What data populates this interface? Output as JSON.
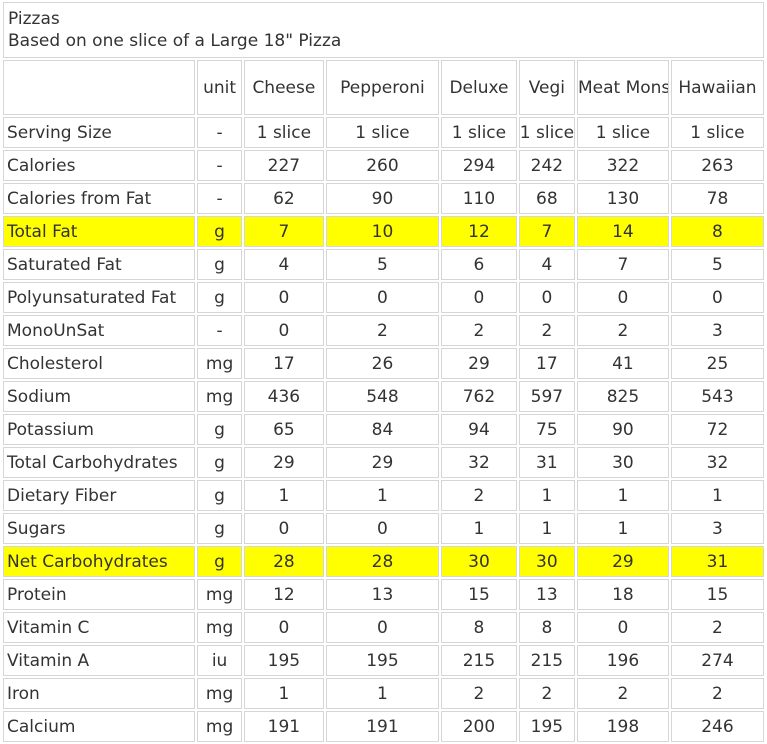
{
  "caption": {
    "title": "Pizzas",
    "subtitle": "Based on one slice of a Large 18\" Pizza"
  },
  "header": {
    "blank": "",
    "unit": "unit",
    "columns": [
      "Cheese",
      "Pepperoni",
      "Deluxe",
      "Vegi",
      "Meat Monster",
      "Hawaiian"
    ]
  },
  "rows": [
    {
      "label": "Serving Size",
      "unit": "-",
      "values": [
        "1 slice",
        "1 slice",
        "1 slice",
        "1 slice",
        "1 slice",
        "1 slice"
      ],
      "highlight": false
    },
    {
      "label": "Calories",
      "unit": "-",
      "values": [
        "227",
        "260",
        "294",
        "242",
        "322",
        "263"
      ],
      "highlight": false
    },
    {
      "label": "Calories from Fat",
      "unit": "-",
      "values": [
        "62",
        "90",
        "110",
        "68",
        "130",
        "78"
      ],
      "highlight": false
    },
    {
      "label": "Total Fat",
      "unit": "g",
      "values": [
        "7",
        "10",
        "12",
        "7",
        "14",
        "8"
      ],
      "highlight": true
    },
    {
      "label": "Saturated Fat",
      "unit": "g",
      "values": [
        "4",
        "5",
        "6",
        "4",
        "7",
        "5"
      ],
      "highlight": false
    },
    {
      "label": "Polyunsaturated Fat",
      "unit": "g",
      "values": [
        "0",
        "0",
        "0",
        "0",
        "0",
        "0"
      ],
      "highlight": false
    },
    {
      "label": "MonoUnSat",
      "unit": "-",
      "values": [
        "0",
        "2",
        "2",
        "2",
        "2",
        "3"
      ],
      "highlight": false
    },
    {
      "label": "Cholesterol",
      "unit": "mg",
      "values": [
        "17",
        "26",
        "29",
        "17",
        "41",
        "25"
      ],
      "highlight": false
    },
    {
      "label": "Sodium",
      "unit": "mg",
      "values": [
        "436",
        "548",
        "762",
        "597",
        "825",
        "543"
      ],
      "highlight": false
    },
    {
      "label": "Potassium",
      "unit": "g",
      "values": [
        "65",
        "84",
        "94",
        "75",
        "90",
        "72"
      ],
      "highlight": false
    },
    {
      "label": "Total Carbohydrates",
      "unit": "g",
      "values": [
        "29",
        "29",
        "32",
        "31",
        "30",
        "32"
      ],
      "highlight": false
    },
    {
      "label": "Dietary Fiber",
      "unit": "g",
      "values": [
        "1",
        "1",
        "2",
        "1",
        "1",
        "1"
      ],
      "highlight": false
    },
    {
      "label": "Sugars",
      "unit": "g",
      "values": [
        "0",
        "0",
        "1",
        "1",
        "1",
        "3"
      ],
      "highlight": false
    },
    {
      "label": "Net Carbohydrates",
      "unit": "g",
      "values": [
        "28",
        "28",
        "30",
        "30",
        "29",
        "31"
      ],
      "highlight": true
    },
    {
      "label": "Protein",
      "unit": "mg",
      "values": [
        "12",
        "13",
        "15",
        "13",
        "18",
        "15"
      ],
      "highlight": false
    },
    {
      "label": "Vitamin C",
      "unit": "mg",
      "values": [
        "0",
        "0",
        "8",
        "8",
        "0",
        "2"
      ],
      "highlight": false
    },
    {
      "label": "Vitamin A",
      "unit": "iu",
      "values": [
        "195",
        "195",
        "215",
        "215",
        "196",
        "274"
      ],
      "highlight": false
    },
    {
      "label": "Iron",
      "unit": "mg",
      "values": [
        "1",
        "1",
        "2",
        "2",
        "2",
        "2"
      ],
      "highlight": false
    },
    {
      "label": "Calcium",
      "unit": "mg",
      "values": [
        "191",
        "191",
        "200",
        "195",
        "198",
        "246"
      ],
      "highlight": false
    }
  ],
  "colors": {
    "highlight": "#ffff00",
    "border": "#d6d6d6",
    "text": "#333333"
  }
}
